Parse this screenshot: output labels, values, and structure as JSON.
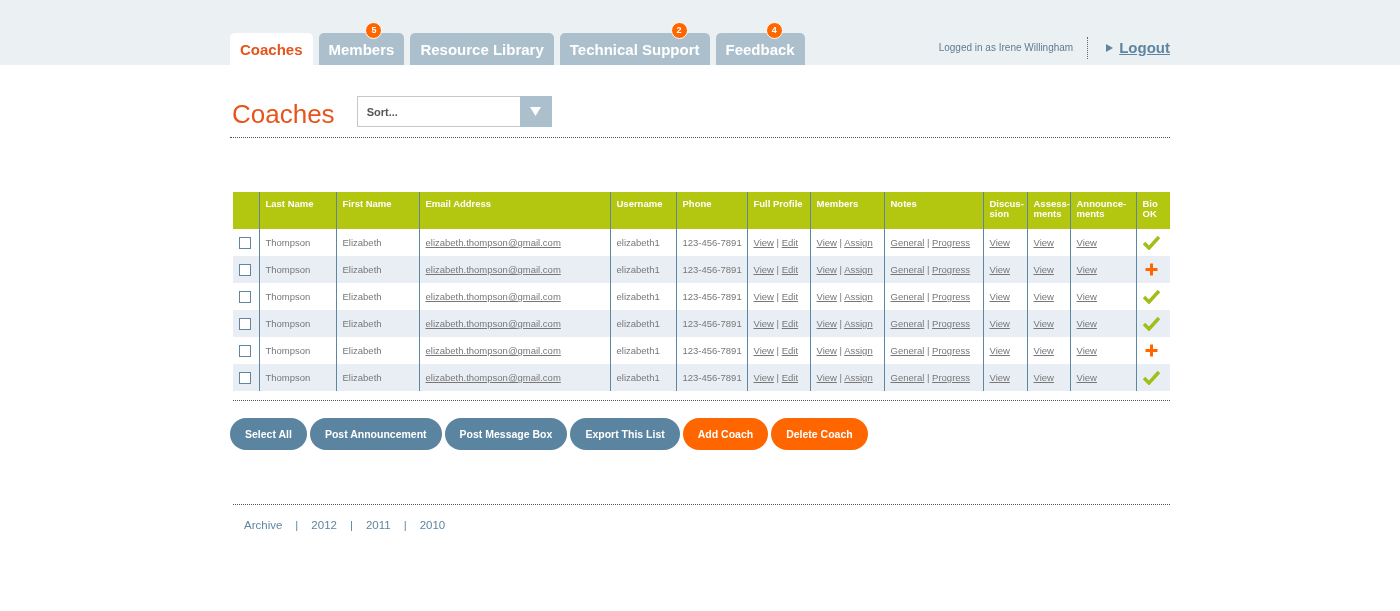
{
  "tabs": [
    {
      "label": "Coaches",
      "selected": true
    },
    {
      "label": "Members",
      "selected": false,
      "badge": "5"
    },
    {
      "label": "Resource Library",
      "selected": false
    },
    {
      "label": "Technical Support",
      "selected": false,
      "badge": "2"
    },
    {
      "label": "Feedback",
      "selected": false,
      "badge": "4"
    }
  ],
  "user": {
    "logged_in": "Logged in as Irene Willingham",
    "logout": "Logout"
  },
  "page_title": "Coaches",
  "sort": {
    "placeholder": "Sort..."
  },
  "table": {
    "columns": [
      "Last Name",
      "First Name",
      "Email Address",
      "Username",
      "Phone",
      "Full Profile",
      "Members",
      "Notes",
      "Discus-\nsion",
      "Assess-\nments",
      "Announce-\nments",
      "Bio\nOK"
    ],
    "link_separator": "|",
    "rows": [
      {
        "checked": false,
        "last_name": "Thompson",
        "first_name": "Elizabeth",
        "email": "elizabeth.thompson@gmail.com",
        "username": "elizabeth1",
        "phone": "123-456-7891",
        "full_profile": [
          "View",
          "Edit"
        ],
        "members": [
          "View",
          "Assign"
        ],
        "notes": [
          "General",
          "Progress"
        ],
        "discussion": "View",
        "assessments": "View",
        "announcements": "View",
        "bio_ok": true
      },
      {
        "checked": false,
        "last_name": "Thompson",
        "first_name": "Elizabeth",
        "email": "elizabeth.thompson@gmail.com",
        "username": "elizabeth1",
        "phone": "123-456-7891",
        "full_profile": [
          "View",
          "Edit"
        ],
        "members": [
          "View",
          "Assign"
        ],
        "notes": [
          "General",
          "Progress"
        ],
        "discussion": "View",
        "assessments": "View",
        "announcements": "View",
        "bio_ok": false
      },
      {
        "checked": false,
        "last_name": "Thompson",
        "first_name": "Elizabeth",
        "email": "elizabeth.thompson@gmail.com",
        "username": "elizabeth1",
        "phone": "123-456-7891",
        "full_profile": [
          "View",
          "Edit"
        ],
        "members": [
          "View",
          "Assign"
        ],
        "notes": [
          "General",
          "Progress"
        ],
        "discussion": "View",
        "assessments": "View",
        "announcements": "View",
        "bio_ok": true
      },
      {
        "checked": false,
        "last_name": "Thompson",
        "first_name": "Elizabeth",
        "email": "elizabeth.thompson@gmail.com",
        "username": "elizabeth1",
        "phone": "123-456-7891",
        "full_profile": [
          "View",
          "Edit"
        ],
        "members": [
          "View",
          "Assign"
        ],
        "notes": [
          "General",
          "Progress"
        ],
        "discussion": "View",
        "assessments": "View",
        "announcements": "View",
        "bio_ok": true
      },
      {
        "checked": false,
        "last_name": "Thompson",
        "first_name": "Elizabeth",
        "email": "elizabeth.thompson@gmail.com",
        "username": "elizabeth1",
        "phone": "123-456-7891",
        "full_profile": [
          "View",
          "Edit"
        ],
        "members": [
          "View",
          "Assign"
        ],
        "notes": [
          "General",
          "Progress"
        ],
        "discussion": "View",
        "assessments": "View",
        "announcements": "View",
        "bio_ok": false
      },
      {
        "checked": false,
        "last_name": "Thompson",
        "first_name": "Elizabeth",
        "email": "elizabeth.thompson@gmail.com",
        "username": "elizabeth1",
        "phone": "123-456-7891",
        "full_profile": [
          "View",
          "Edit"
        ],
        "members": [
          "View",
          "Assign"
        ],
        "notes": [
          "General",
          "Progress"
        ],
        "discussion": "View",
        "assessments": "View",
        "announcements": "View",
        "bio_ok": true
      }
    ]
  },
  "buttons": [
    {
      "label": "Select All",
      "kind": "secondary"
    },
    {
      "label": "Post Announcement",
      "kind": "secondary"
    },
    {
      "label": "Post Message Box",
      "kind": "secondary"
    },
    {
      "label": "Export This List",
      "kind": "secondary"
    },
    {
      "label": "Add Coach",
      "kind": "primary"
    },
    {
      "label": "Delete Coach",
      "kind": "primary"
    }
  ],
  "archive": {
    "separator": "|",
    "links": [
      "Archive",
      "2012",
      "2011",
      "2010"
    ]
  }
}
